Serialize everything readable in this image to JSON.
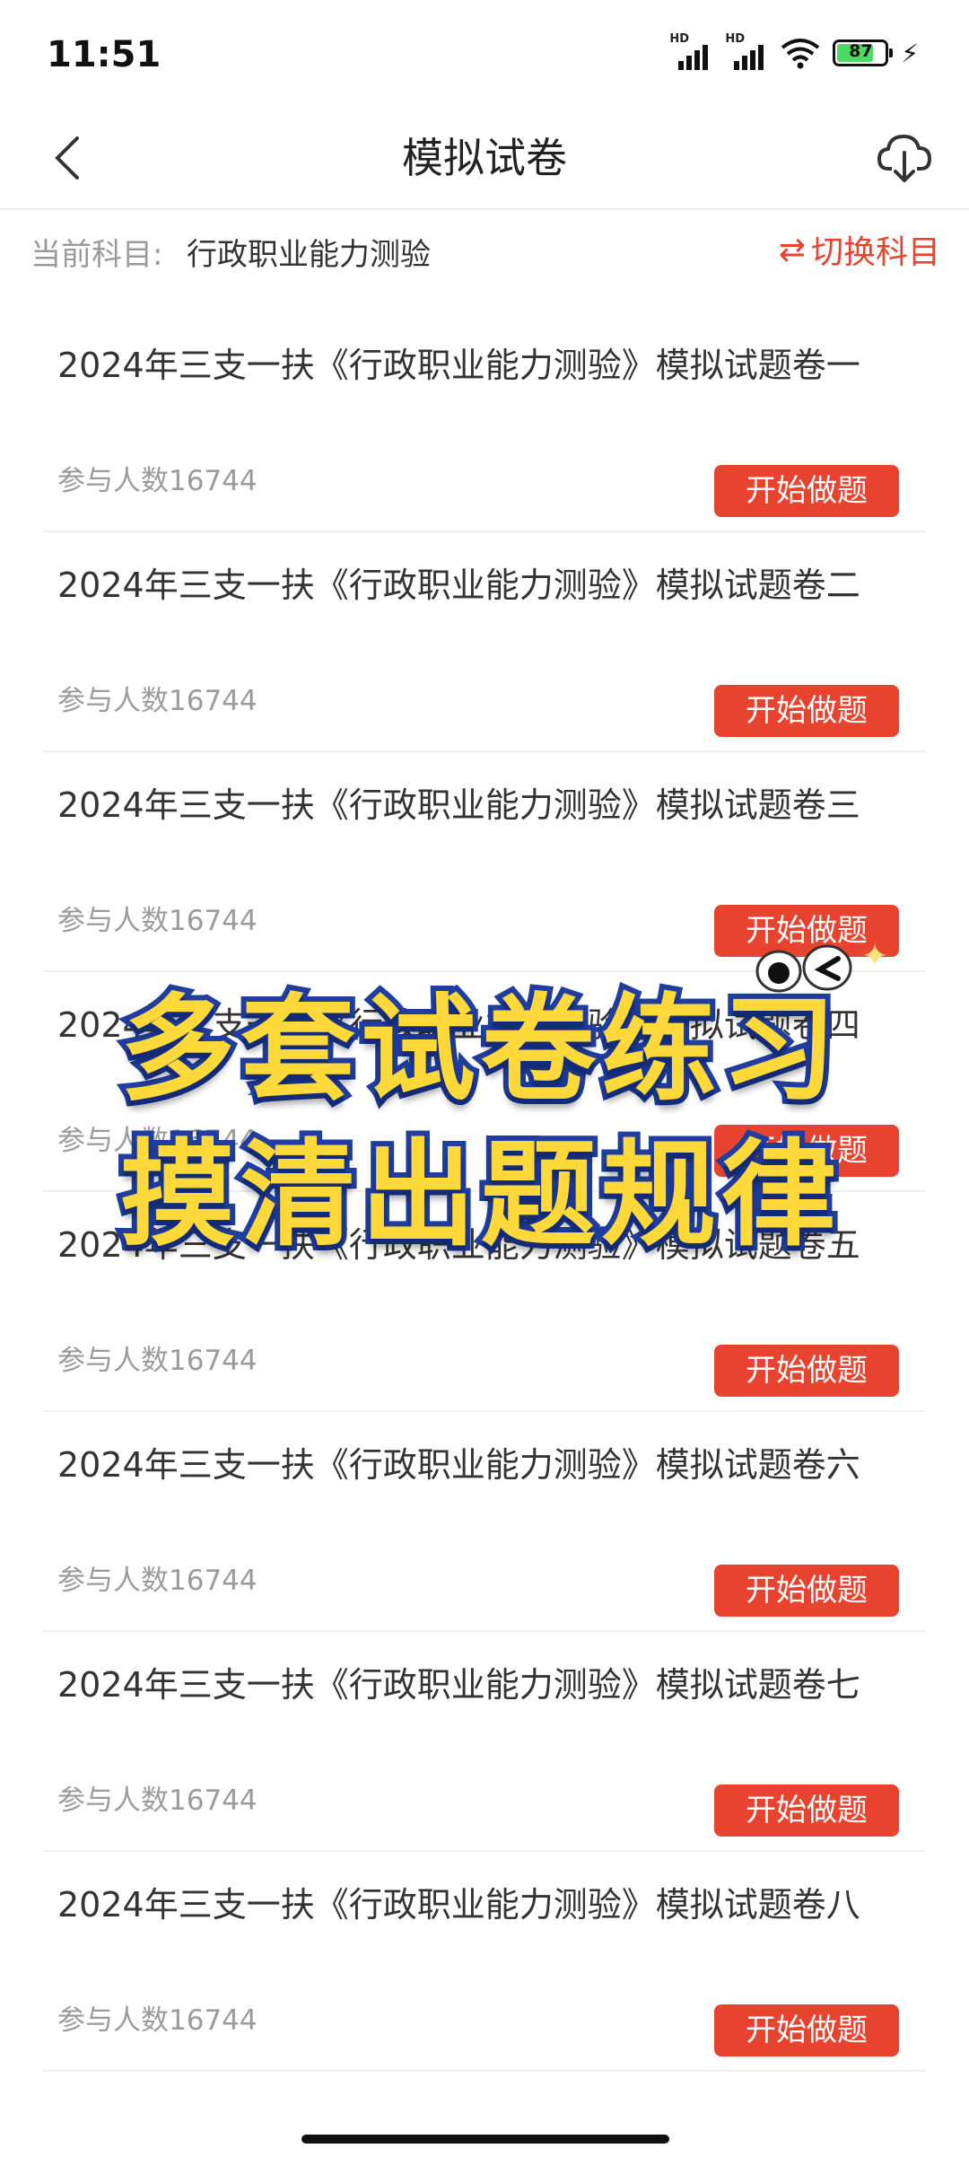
{
  "status_bar": {
    "time": "11:51",
    "battery": "87"
  },
  "nav": {
    "title": "模拟试卷"
  },
  "subject": {
    "label": "当前科目:",
    "value": "行政职业能力测验",
    "switch_label": "切换科目"
  },
  "papers": [
    {
      "title": "2024年三支一扶《行政职业能力测验》模拟试题卷一",
      "count": "参与人数16744",
      "button": "开始做题"
    },
    {
      "title": "2024年三支一扶《行政职业能力测验》模拟试题卷二",
      "count": "参与人数16744",
      "button": "开始做题"
    },
    {
      "title": "2024年三支一扶《行政职业能力测验》模拟试题卷三",
      "count": "参与人数16744",
      "button": "开始做题"
    },
    {
      "title": "2024年三支一扶《行政职业能力测验》模拟试题卷四",
      "count": "参与人数16744",
      "button": "开始做题"
    },
    {
      "title": "2024年三支一扶《行政职业能力测验》模拟试题卷五",
      "count": "参与人数16744",
      "button": "开始做题"
    },
    {
      "title": "2024年三支一扶《行政职业能力测验》模拟试题卷六",
      "count": "参与人数16744",
      "button": "开始做题"
    },
    {
      "title": "2024年三支一扶《行政职业能力测验》模拟试题卷七",
      "count": "参与人数16744",
      "button": "开始做题"
    },
    {
      "title": "2024年三支一扶《行政职业能力测验》模拟试题卷八",
      "count": "参与人数16744",
      "button": "开始做题"
    }
  ],
  "promo": {
    "line1": "多套试卷练习",
    "line2": "摸清出题规律"
  },
  "colors": {
    "accent": "#e8432f",
    "promo_fill": "#ffd83a",
    "promo_stroke": "#1f3ea0"
  }
}
